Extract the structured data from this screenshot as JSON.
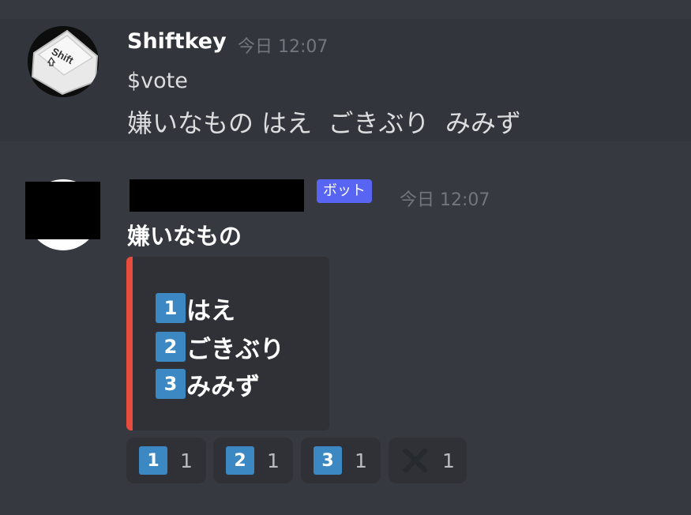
{
  "messages": [
    {
      "author": "Shiftkey",
      "timestamp": "今日 12:07",
      "avatar_text": "Shift",
      "lines": [
        "$vote",
        "嫌いなもの はえ  ごきぶり  みみず"
      ]
    },
    {
      "author": "",
      "bot_tag": "ボット",
      "timestamp": "今日 12:07",
      "title": "嫌いなもの",
      "embed": {
        "accent_color": "#e74c3c",
        "options": [
          {
            "key": "1",
            "label": "はえ"
          },
          {
            "key": "2",
            "label": "ごきぶり"
          },
          {
            "key": "3",
            "label": "みみず"
          }
        ]
      },
      "reactions": [
        {
          "emoji": "1",
          "count": "1"
        },
        {
          "emoji": "2",
          "count": "1"
        },
        {
          "emoji": "3",
          "count": "1"
        },
        {
          "emoji": "x-icon",
          "count": "1"
        }
      ]
    }
  ],
  "colors": {
    "background": "#36393f",
    "keycap": "#3b88c3",
    "bot_tag": "#5865f2"
  }
}
